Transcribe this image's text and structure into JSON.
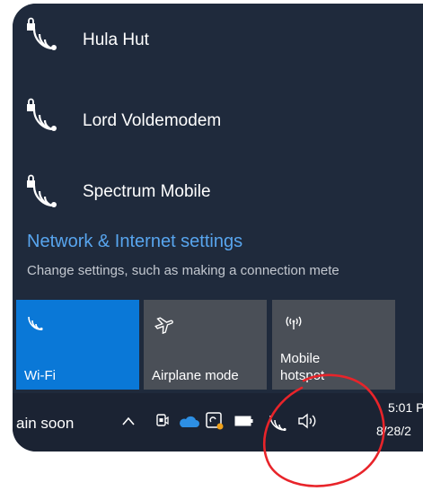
{
  "wifi_networks": [
    {
      "name": "Hula Hut",
      "icon": "wifi-secured-icon"
    },
    {
      "name": "Lord Voldemodem",
      "icon": "wifi-secured-icon"
    },
    {
      "name": "Spectrum Mobile",
      "icon": "wifi-secured-icon"
    }
  ],
  "settings": {
    "link": "Network & Internet settings",
    "description": "Change settings, such as making a connection mete"
  },
  "quick_actions": [
    {
      "label": "Wi-Fi",
      "active": true,
      "icon": "wifi-icon"
    },
    {
      "label": "Airplane mode",
      "active": false,
      "icon": "airplane-icon"
    },
    {
      "label": "Mobile\nhotspot",
      "line1": "Mobile",
      "line2": "hotspot",
      "active": false,
      "icon": "hotspot-icon"
    }
  ],
  "taskbar": {
    "left_text": "ain soon",
    "time": "5:01 P",
    "date": "8/28/2"
  },
  "colors": {
    "accent": "#0a78d7",
    "link": "#58a5ee",
    "annotation": "#e8242a"
  }
}
